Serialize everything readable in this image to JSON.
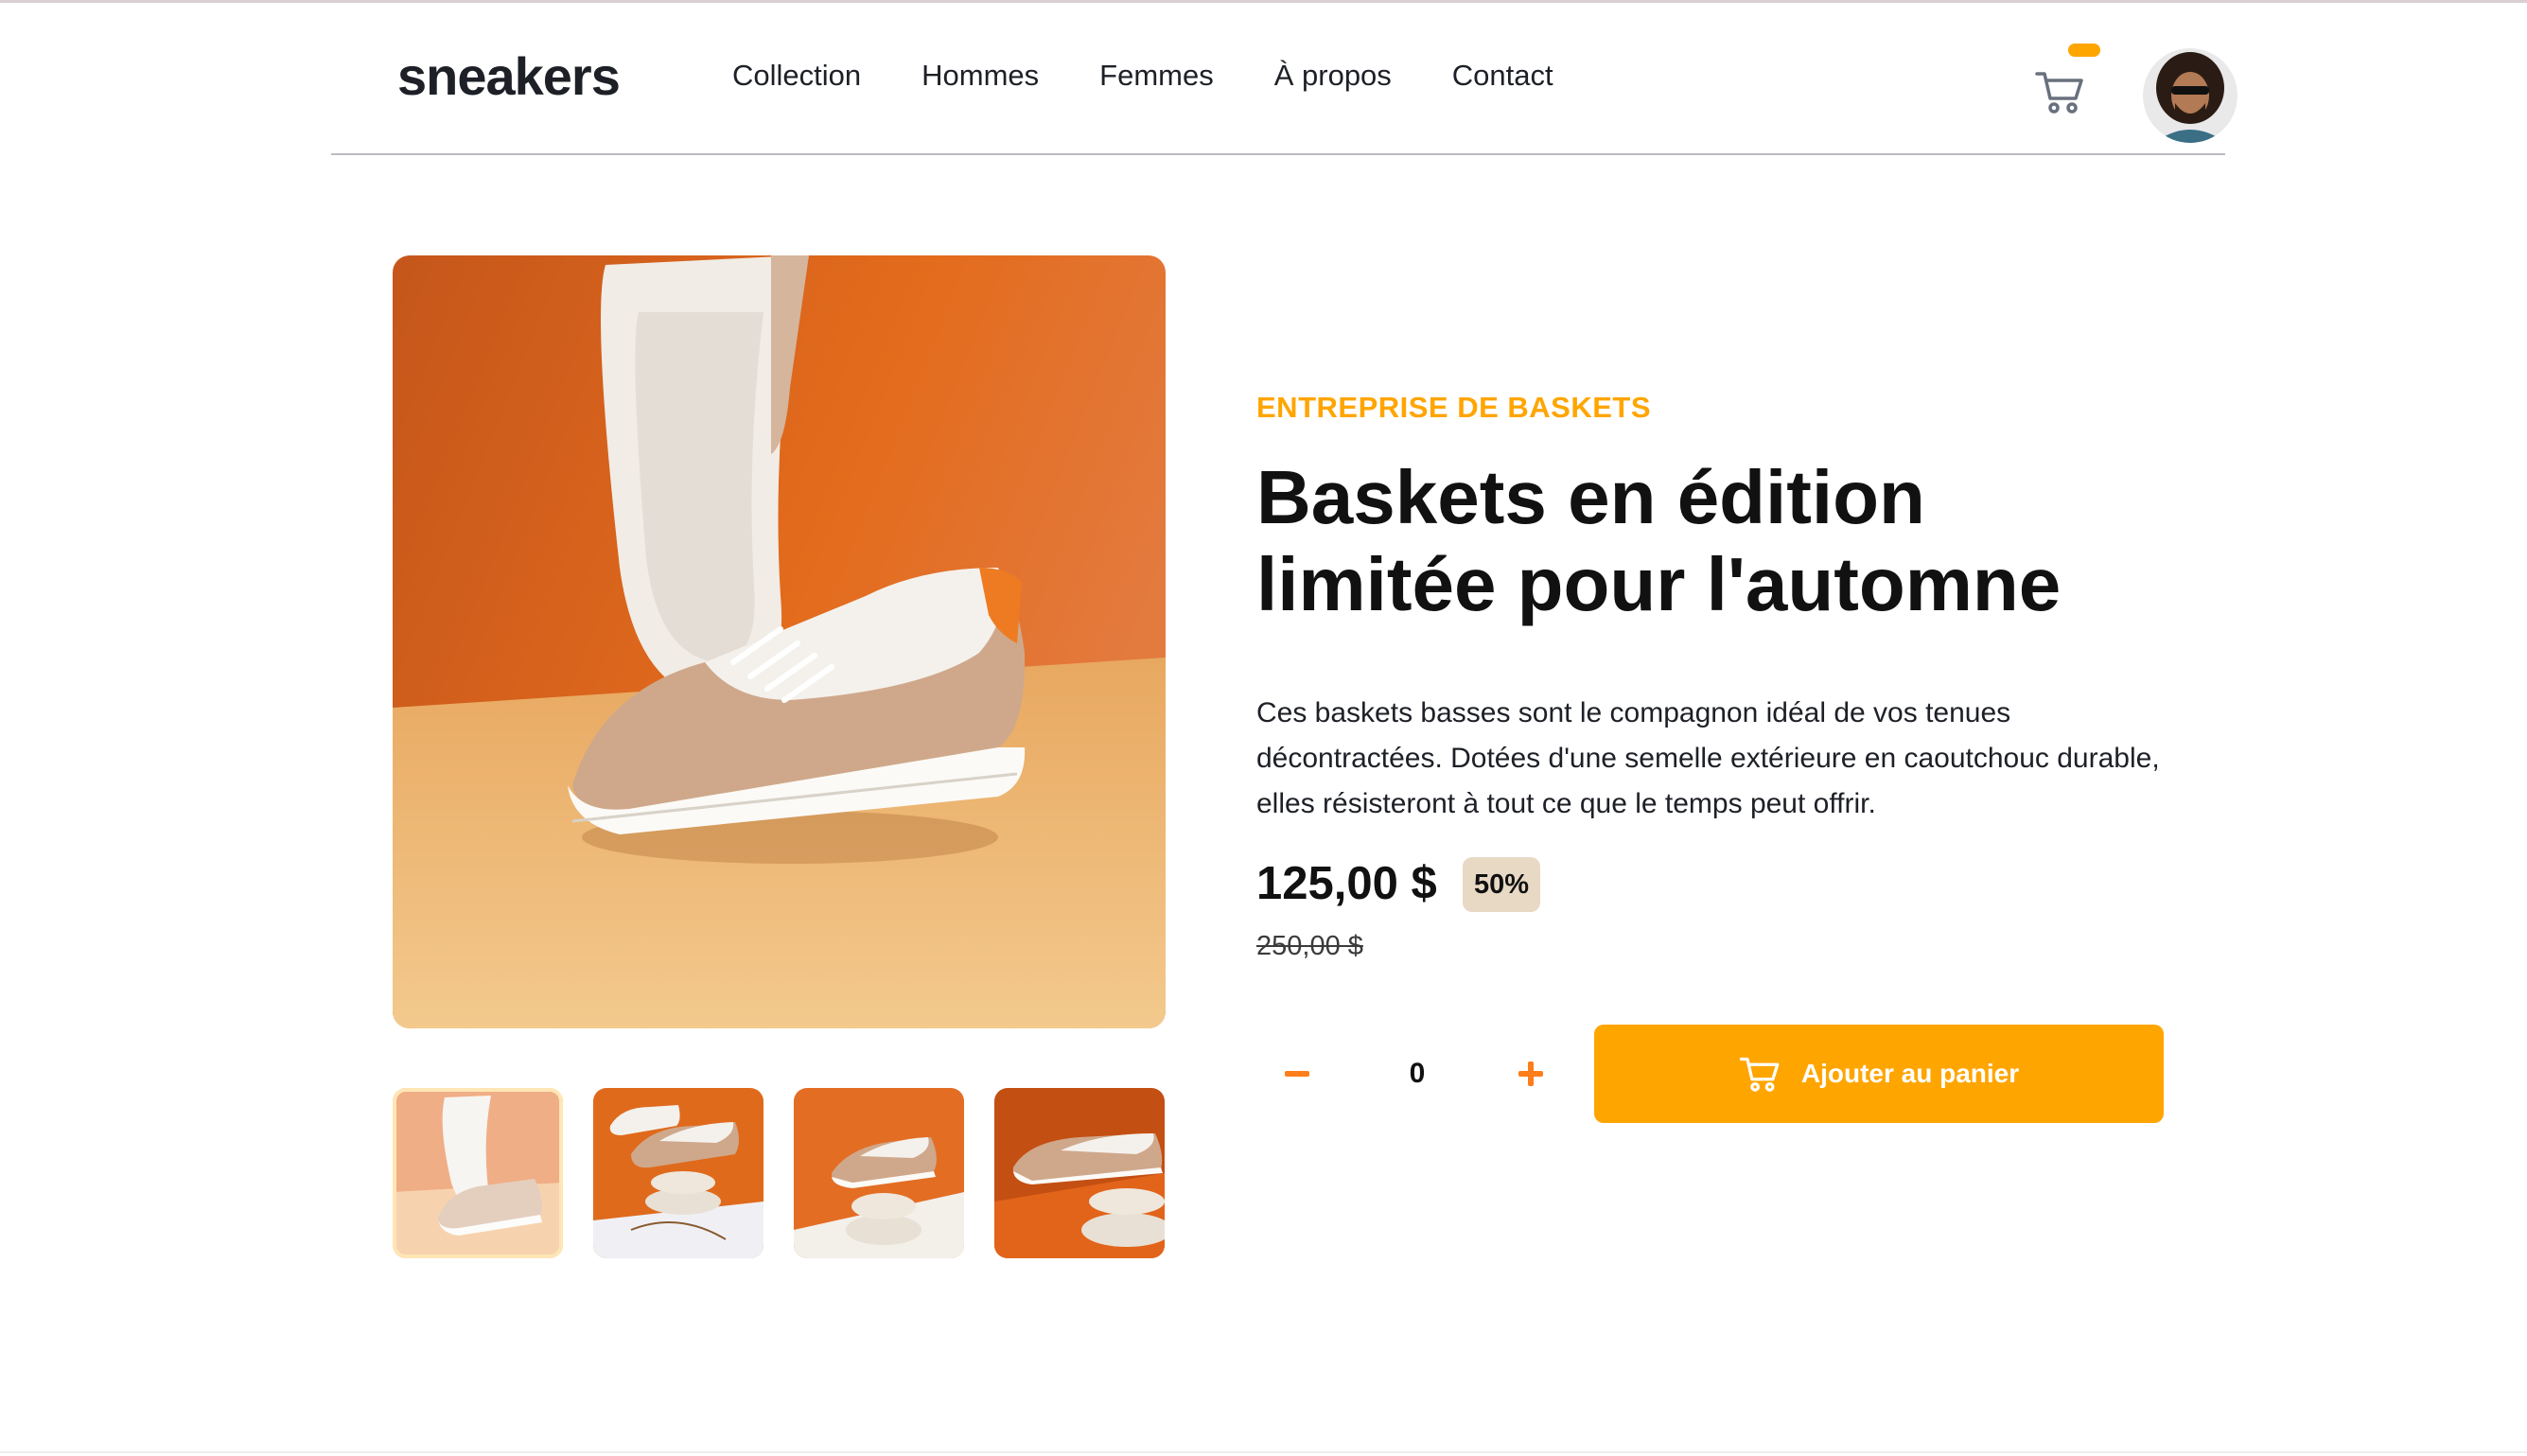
{
  "header": {
    "logo": "sneakers",
    "nav": [
      "Collection",
      "Hommes",
      "Femmes",
      "À propos",
      "Contact"
    ]
  },
  "product": {
    "company": "ENTREPRISE DE BASKETS",
    "title": "Baskets en édition limitée pour l'automne",
    "description": "Ces baskets basses sont le compagnon idéal de vos tenues décontractées. Dotées d'une semelle extérieure en caoutchouc durable, elles résisteront à tout ce que le temps peut offrir.",
    "price": "125,00 $",
    "discount": "50%",
    "old_price": "250,00 $",
    "quantity": "0",
    "add_to_cart_label": "Ajouter au panier"
  },
  "colors": {
    "accent": "#ffa500",
    "accent_dark": "#ff7d1a",
    "discount_bg": "#e8d9c5",
    "text": "#1d2026"
  },
  "icons": [
    "cart-icon",
    "minus-icon",
    "plus-icon"
  ]
}
